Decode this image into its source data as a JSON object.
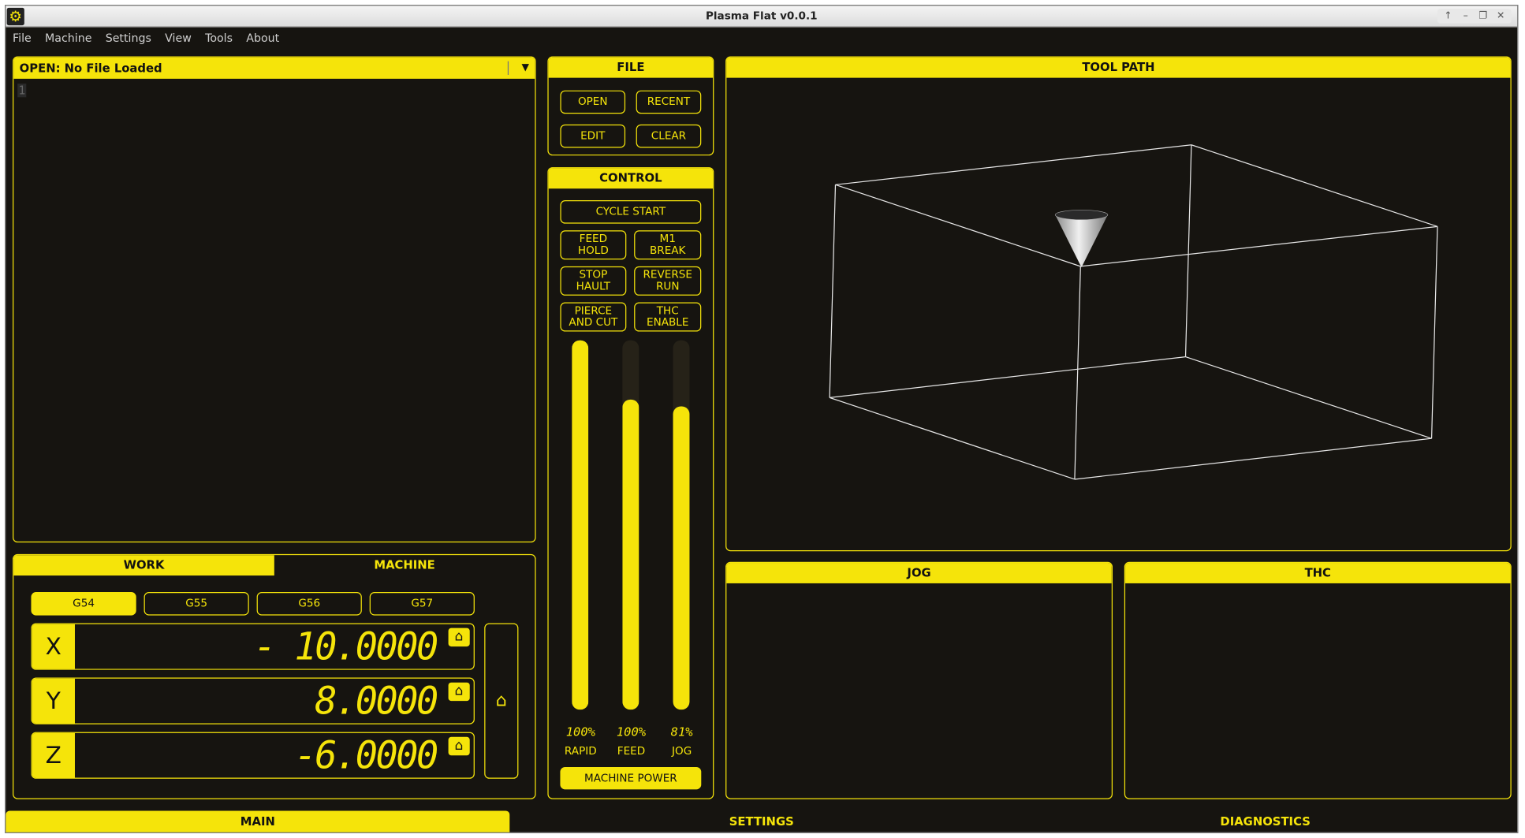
{
  "window": {
    "title": "Plasma Flat v0.0.1",
    "controls": [
      "↑",
      "–",
      "❐",
      "✕"
    ]
  },
  "menu": [
    "File",
    "Machine",
    "Settings",
    "View",
    "Tools",
    "About"
  ],
  "editor": {
    "open_label": "OPEN:  No File Loaded",
    "line_number": "1"
  },
  "file_panel": {
    "title": "FILE",
    "open": "OPEN",
    "recent": "RECENT",
    "edit": "EDIT",
    "clear": "CLEAR"
  },
  "control_panel": {
    "title": "CONTROL",
    "cycle_start": "CYCLE START",
    "feed_hold": "FEED\nHOLD",
    "m1_break": "M1\nBREAK",
    "stop_hault": "STOP\nHAULT",
    "reverse_run": "REVERSE\nRUN",
    "pierce_and_cut": "PIERCE\nAND CUT",
    "thc_enable": "THC\nENABLE",
    "machine_power": "MACHINE POWER"
  },
  "overrides": [
    {
      "label": "RAPID",
      "percent_text": "100%",
      "value": 1.0
    },
    {
      "label": "FEED",
      "percent_text": "100%",
      "value": 0.84
    },
    {
      "label": "JOG",
      "percent_text": "81%",
      "value": 0.82
    }
  ],
  "dro": {
    "tabs": {
      "work": "WORK",
      "machine": "MACHINE"
    },
    "offsets": [
      "G54",
      "G55",
      "G56",
      "G57"
    ],
    "active_offset": "G54",
    "axes": [
      {
        "axis": "X",
        "value": "- 10.0000"
      },
      {
        "axis": "Y",
        "value": "8.0000"
      },
      {
        "axis": "Z",
        "value": "-6.0000"
      }
    ]
  },
  "tool_path": {
    "title": "TOOL PATH"
  },
  "jog": {
    "title": "JOG"
  },
  "thc": {
    "title": "THC"
  },
  "bottom_tabs": [
    "MAIN",
    "SETTINGS",
    "DIAGNOSTICS"
  ],
  "colors": {
    "accent": "#f5e40a",
    "background": "#161410"
  },
  "icons": {
    "app": "gear-icon",
    "home": "home-icon",
    "dropdown": "chevron-down-icon"
  }
}
